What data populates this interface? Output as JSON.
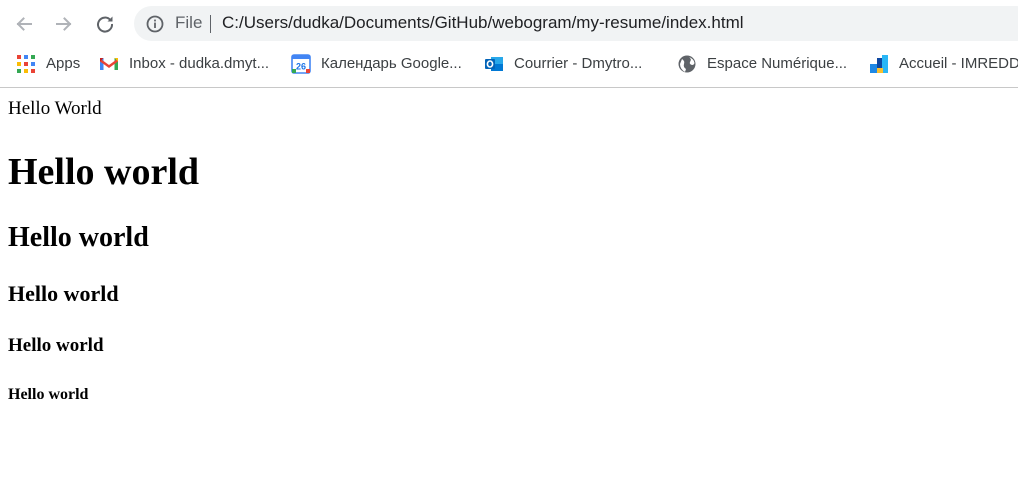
{
  "browser": {
    "omnibox": {
      "scheme_label": "File",
      "url": "C:/Users/dudka/Documents/GitHub/webogram/my-resume/index.html"
    },
    "bookmarks": [
      {
        "label": "Apps",
        "icon": "apps-grid-icon"
      },
      {
        "label": "Inbox - dudka.dmyt...",
        "icon": "gmail-icon"
      },
      {
        "label": "Календарь Google...",
        "icon": "google-calendar-icon"
      },
      {
        "label": "Courrier - Dmytro...",
        "icon": "outlook-icon"
      },
      {
        "label": "Espace Numérique...",
        "icon": "globe-icon"
      },
      {
        "label": "Accueil - IMREDD",
        "icon": "imredd-icon"
      }
    ],
    "calendar_day": "26"
  },
  "page": {
    "body_text": "Hello World",
    "h1": "Hello world",
    "h2": "Hello world",
    "h3": "Hello world",
    "h4": "Hello world",
    "h5": "Hello world"
  },
  "colors": {
    "toolbar_icon": "#5f6368",
    "omnibox_bg": "#f1f3f4",
    "gmail_red": "#ea4335",
    "calendar_blue": "#4285f4",
    "outlook_blue": "#0364b8"
  }
}
